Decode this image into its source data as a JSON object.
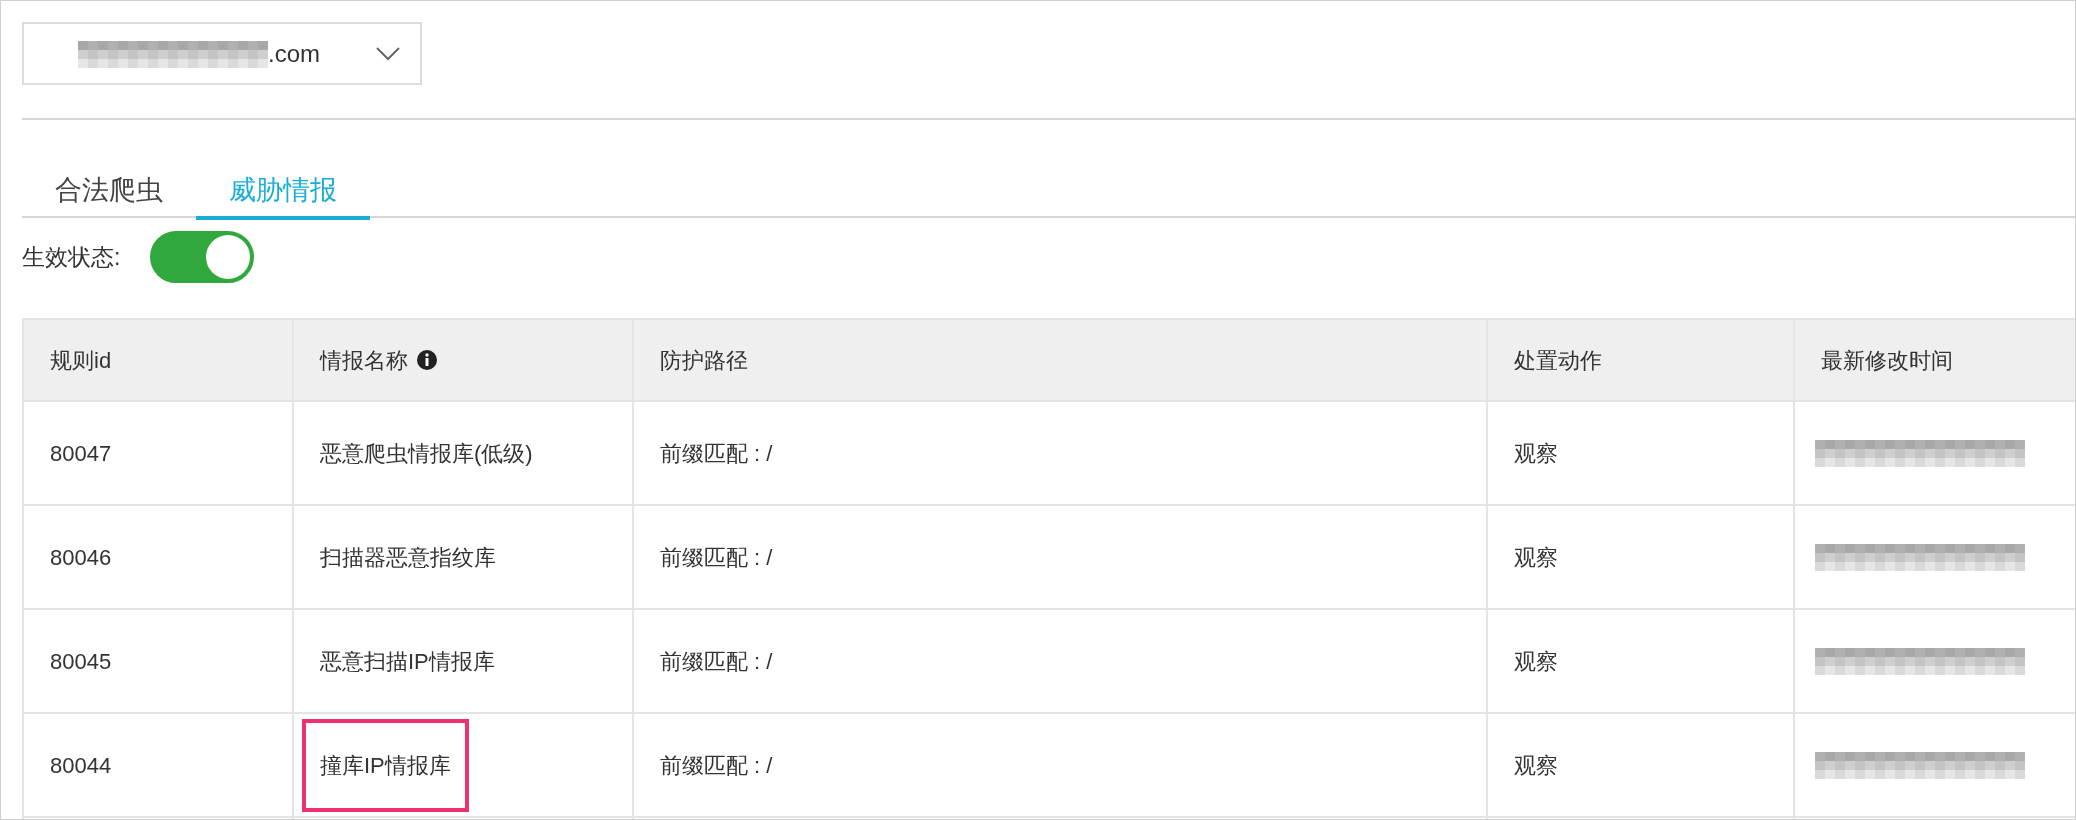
{
  "domain_select": {
    "value": ".com",
    "redacted_prefix": true
  },
  "tabs": [
    {
      "label": "合法爬虫",
      "selected": false
    },
    {
      "label": "威胁情报",
      "selected": true
    }
  ],
  "status_toggle": {
    "label": "生效状态:",
    "on": true
  },
  "table": {
    "columns": [
      {
        "label": "规则id"
      },
      {
        "label": "情报名称",
        "info": true
      },
      {
        "label": "防护路径"
      },
      {
        "label": "处置动作"
      },
      {
        "label": "最新修改时间"
      }
    ],
    "rows": [
      {
        "id": "80047",
        "name": "恶意爬虫情报库(低级)",
        "path": "前缀匹配 : /",
        "action": "观察",
        "time_redacted": true,
        "highlighted": false
      },
      {
        "id": "80046",
        "name": "扫描器恶意指纹库",
        "path": "前缀匹配 : /",
        "action": "观察",
        "time_redacted": true,
        "highlighted": false
      },
      {
        "id": "80045",
        "name": "恶意扫描IP情报库",
        "path": "前缀匹配 : /",
        "action": "观察",
        "time_redacted": true,
        "highlighted": false
      },
      {
        "id": "80044",
        "name": "撞库IP情报库",
        "path": "前缀匹配 : /",
        "action": "观察",
        "time_redacted": true,
        "highlighted": true
      }
    ]
  }
}
